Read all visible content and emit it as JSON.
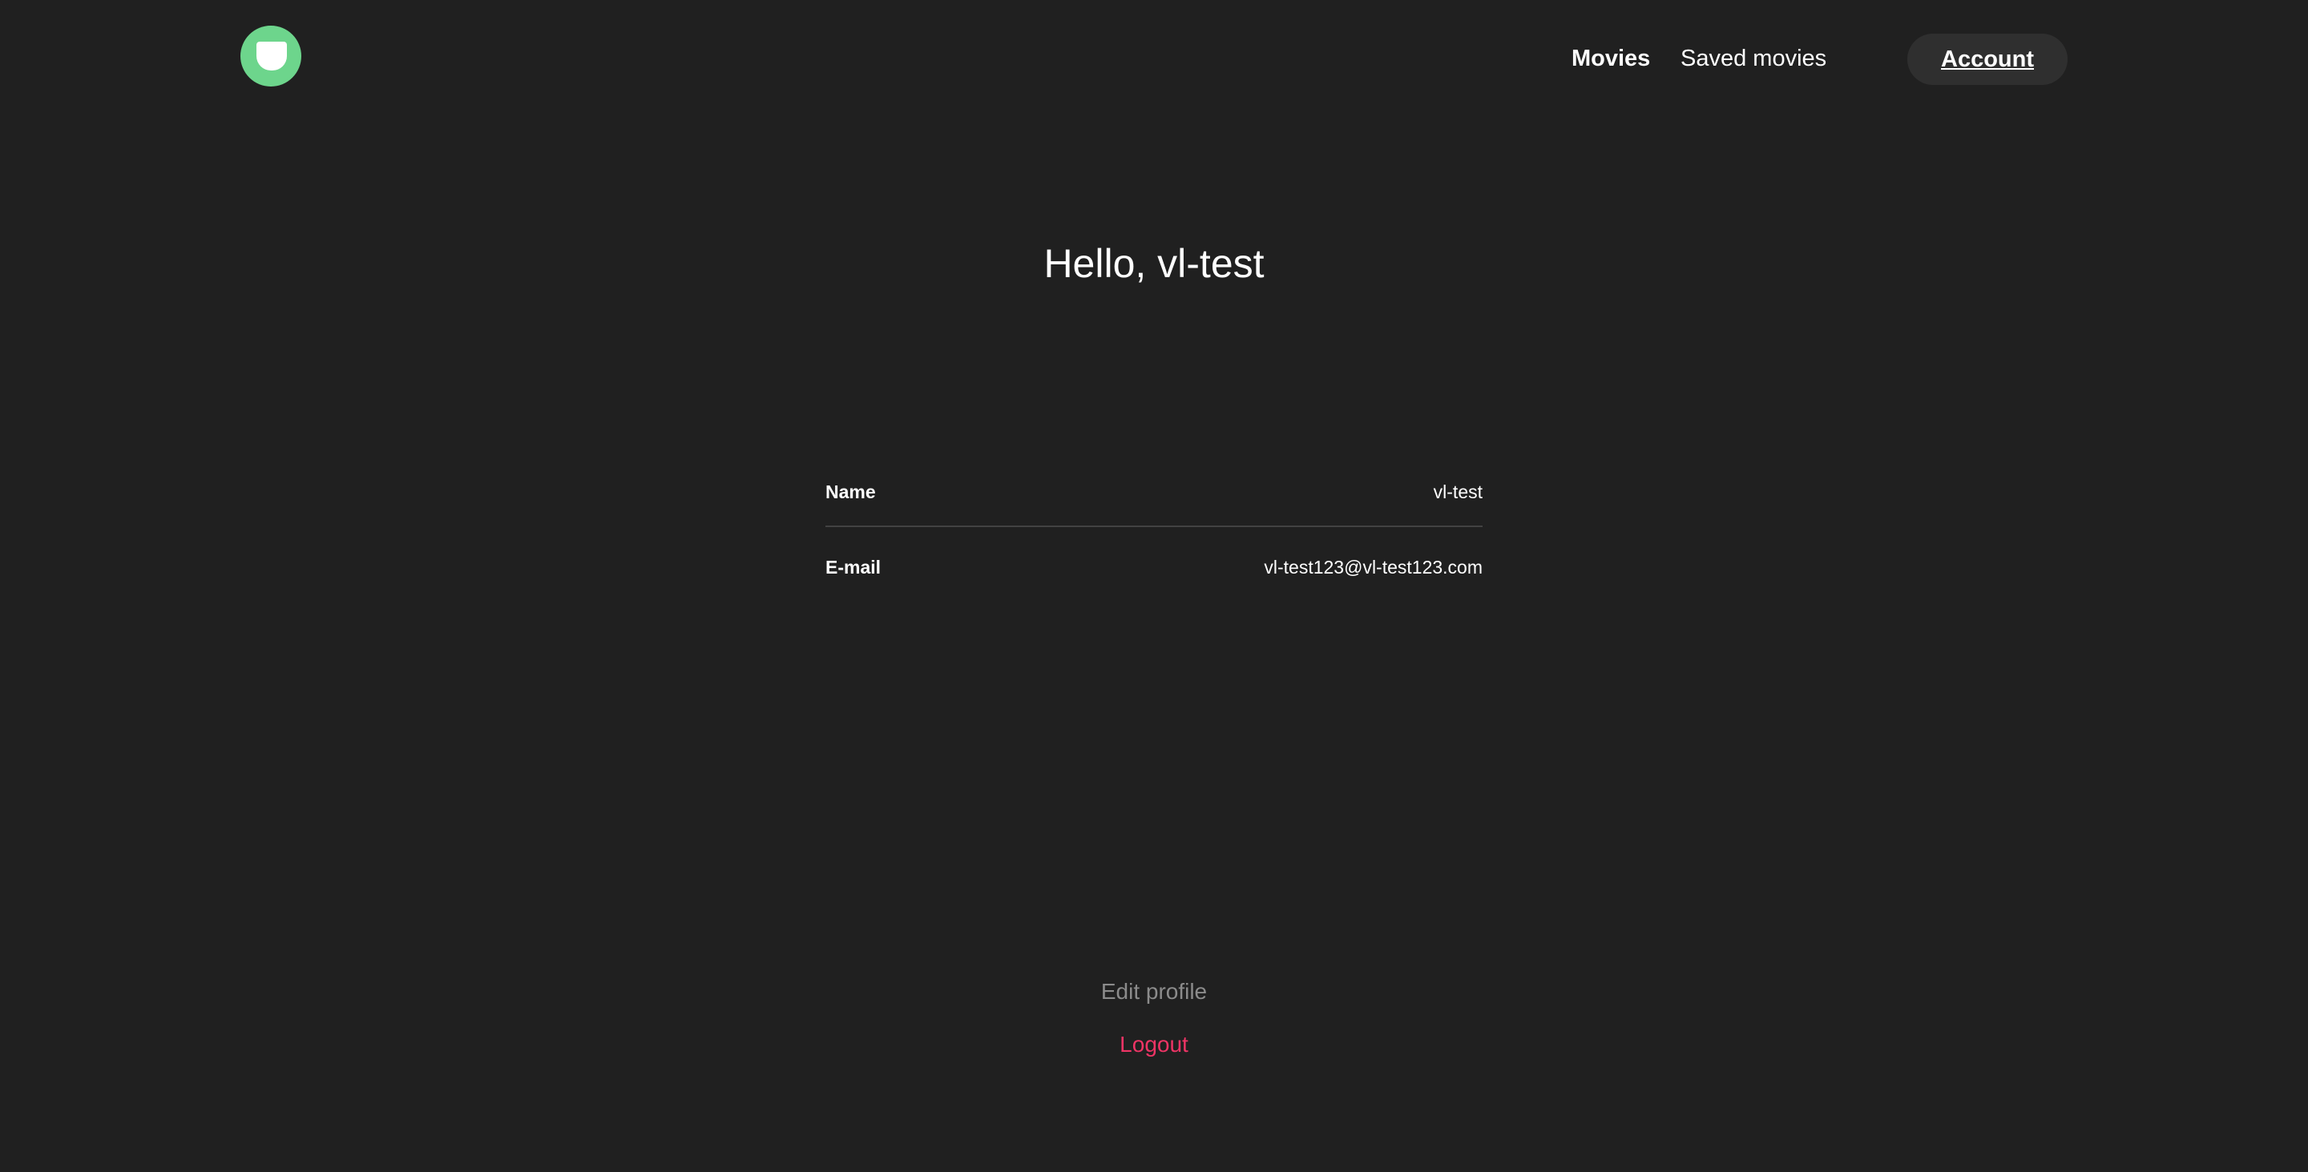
{
  "header": {
    "nav": {
      "movies": "Movies",
      "saved_movies": "Saved movies"
    },
    "account_label": "Account"
  },
  "profile": {
    "greeting": "Hello, vl-test",
    "rows": [
      {
        "label": "Name",
        "value": "vl-test"
      },
      {
        "label": "E-mail",
        "value": "vl-test123@vl-test123.com"
      }
    ],
    "edit_label": "Edit profile",
    "logout_label": "Logout"
  },
  "colors": {
    "background": "#202020",
    "logo": "#6dd58c",
    "account_button": "#2f2f2f",
    "edit_text": "#8b8b8b",
    "logout_text": "#ee3465",
    "divider": "#424242"
  }
}
